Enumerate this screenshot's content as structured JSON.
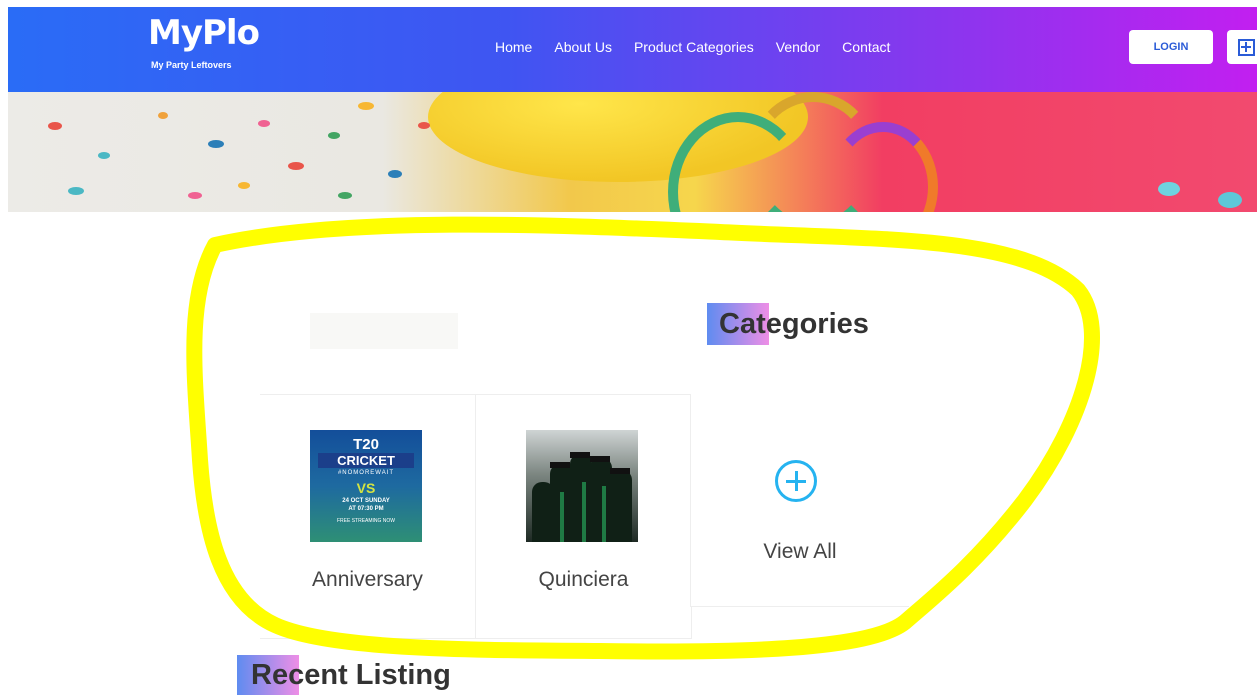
{
  "header": {
    "logo": {
      "main": "MyPlo",
      "sub": "My Party Leftovers"
    },
    "nav": [
      "Home",
      "About Us",
      "Product Categories",
      "Vendor",
      "Contact"
    ],
    "login_label": "LOGIN",
    "add_icon": "plus-square-icon"
  },
  "categories": {
    "title": "Categories",
    "items": [
      {
        "label": "Anniversary",
        "image": {
          "line1": "T20",
          "line2": "CRICKET",
          "line3": "#NOMOREWAIT",
          "vs": "VS",
          "line4": "24 OCT SUNDAY",
          "line5": "AT 07:30 PM",
          "line6": "FREE STREAMING NOW"
        }
      },
      {
        "label": "Quinciera"
      },
      {
        "label": "View All",
        "icon": "plus-circle-icon"
      }
    ]
  },
  "recent": {
    "title": "Recent Listing"
  },
  "colors": {
    "header_start": "#2a6cf6",
    "header_end": "#c21ff0",
    "accent_blue": "#25b3f0",
    "highlight": "#ffff00"
  }
}
